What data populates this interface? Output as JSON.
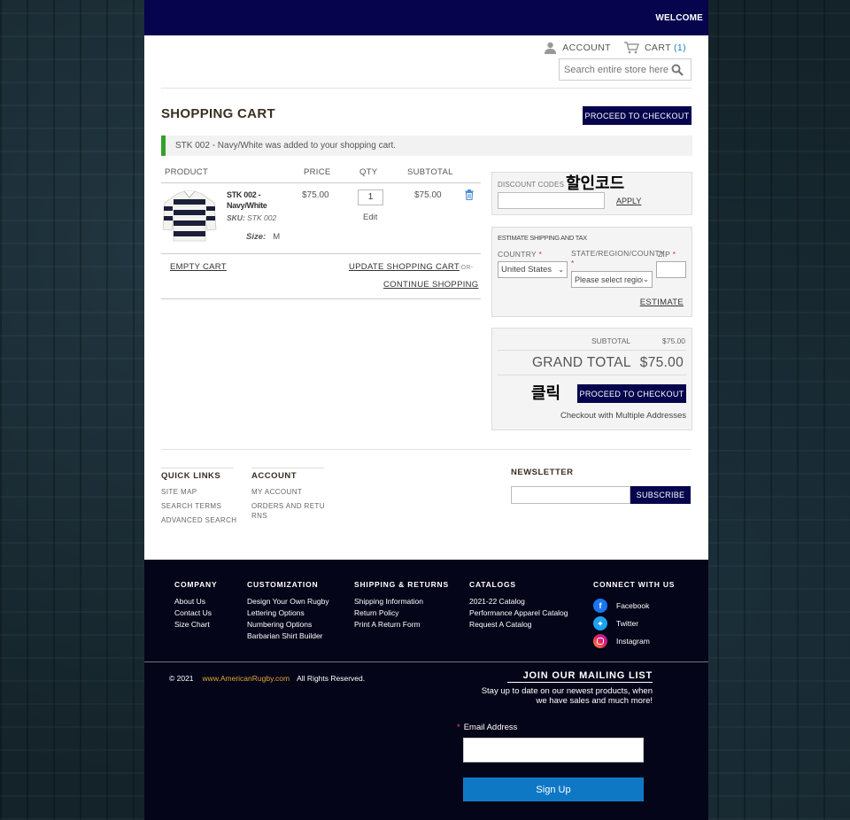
{
  "topbar": {
    "welcome": "WELCOME"
  },
  "header": {
    "account_label": "ACCOUNT",
    "cart_label": "CART",
    "cart_count": "(1)",
    "search_placeholder": "Search entire store here..."
  },
  "page": {
    "title": "SHOPPING CART",
    "proceed_label": "PROCEED TO CHECKOUT",
    "message": "STK 002 - Navy/White was added to your shopping cart."
  },
  "cart": {
    "headers": {
      "product": "PRODUCT",
      "price": "PRICE",
      "qty": "QTY",
      "subtotal": "SUBTOTAL"
    },
    "items": [
      {
        "name": "STK 002 - Navy/White",
        "sku_label": "SKU:",
        "sku": "STK 002",
        "size_label": "Size:",
        "size": "M",
        "price": "$75.00",
        "qty": "1",
        "edit": "Edit",
        "subtotal": "$75.00"
      }
    ],
    "empty_cart": "EMPTY CART",
    "update_cart": "UPDATE SHOPPING CART",
    "or": "-OR-",
    "continue": "CONTINUE SHOPPING"
  },
  "discount": {
    "label": "DISCOUNT CODES",
    "apply": "APPLY",
    "annotation": "할인코드"
  },
  "estimate": {
    "title": "ESTIMATE SHIPPING AND TAX",
    "country_label": "COUNTRY",
    "country_value": "United States",
    "state_label": "STATE/REGION/COUNTY",
    "state_value": "Please select region",
    "zip_label": "ZIP",
    "required_mark": "*",
    "estimate_link": "ESTIMATE"
  },
  "totals": {
    "subtotal_label": "SUBTOTAL",
    "subtotal_value": "$75.00",
    "grand_label": "GRAND TOTAL",
    "grand_value": "$75.00",
    "proceed_label": "PROCEED TO CHECKOUT",
    "multi": "Checkout with Multiple Addresses",
    "annotation": "클릭"
  },
  "footer_links": {
    "quick_links": {
      "title": "QUICK LINKS",
      "items": [
        "SITE MAP",
        "SEARCH TERMS",
        "ADVANCED SEARCH"
      ]
    },
    "account": {
      "title": "ACCOUNT",
      "items": [
        "MY ACCOUNT",
        "ORDERS AND RETURNS"
      ]
    },
    "newsletter": {
      "title": "NEWSLETTER",
      "subscribe": "SUBSCRIBE"
    }
  },
  "footer": {
    "company": {
      "title": "COMPANY",
      "items": [
        "About Us",
        "Contact Us",
        "Size Chart"
      ]
    },
    "customization": {
      "title": "CUSTOMIZATION",
      "items": [
        "Design Your Own Rugby",
        "Lettering Options",
        "Numbering Options",
        "Barbarian Shirt Builder"
      ]
    },
    "shipping": {
      "title": "SHIPPING & RETURNS",
      "items": [
        "Shipping Information",
        "Return Policy",
        "Print A Return Form"
      ]
    },
    "catalogs": {
      "title": "CATALOGS",
      "items": [
        "2021-22 Catalog",
        "Performance Apparel Catalog",
        "Request A Catalog"
      ]
    },
    "connect": {
      "title": "CONNECT WITH US",
      "facebook": "Facebook",
      "twitter": "Twitter",
      "instagram": "Instagram"
    },
    "copyright": "© 2021",
    "site": "www.AmericanRugby.com",
    "rights": "All Rights Reserved.",
    "mailing_title": "JOIN OUR MAILING LIST",
    "mailing_sub": "Stay up to date on our newest products, when we have sales and much more!",
    "email_label": "Email Address",
    "required_mark": "*",
    "signup": "Sign Up"
  },
  "colors": {
    "navy": "#05044d",
    "accent_blue": "#0f78c4",
    "success_green": "#33a02c",
    "link_orange": "#e0a82e"
  }
}
